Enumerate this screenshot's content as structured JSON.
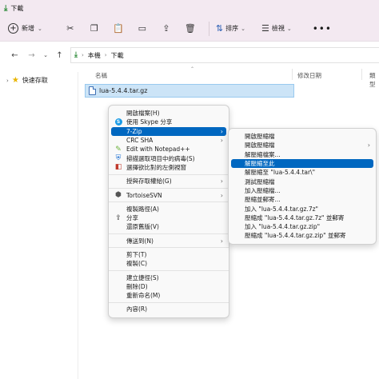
{
  "window": {
    "title": "下載"
  },
  "toolbar": {
    "new_label": "新增",
    "sort_label": "排序",
    "view_label": "檢視",
    "more_label": "•••"
  },
  "address": {
    "back": "←",
    "forward": "→",
    "up": "↑",
    "crumbs": [
      "本機",
      "下載"
    ]
  },
  "sidebar": {
    "quick_access": "快速存取"
  },
  "columns": {
    "name": "名稱",
    "modified": "修改日期",
    "type": "類型"
  },
  "file": {
    "name": "lua-5.4.4.tar.gz"
  },
  "context_menu": {
    "items": [
      {
        "label": "開啟檔案(H)",
        "type": "item"
      },
      {
        "label": "使用 Skype 分享",
        "type": "item",
        "icon": "skype-icon"
      },
      {
        "label": "7-Zip",
        "type": "submenu",
        "selected": true
      },
      {
        "label": "CRC SHA",
        "type": "submenu"
      },
      {
        "label": "Edit with Notepad++",
        "type": "item",
        "icon": "notepad-plus-plus-icon"
      },
      {
        "label": "掃描選取項目中的病毒(S)",
        "type": "item",
        "icon": "shield-icon"
      },
      {
        "label": "選擇欲比對的左側視窗",
        "type": "item",
        "icon": "compare-icon"
      },
      {
        "type": "divider"
      },
      {
        "label": "授與存取權給(G)",
        "type": "submenu"
      },
      {
        "type": "divider"
      },
      {
        "label": "TortoiseSVN",
        "type": "submenu",
        "icon": "tortoise-svn-icon"
      },
      {
        "type": "divider"
      },
      {
        "label": "複製路徑(A)",
        "type": "item"
      },
      {
        "label": "分享",
        "type": "item",
        "icon": "share-icon"
      },
      {
        "label": "還原舊版(V)",
        "type": "item"
      },
      {
        "type": "divider"
      },
      {
        "label": "傳送到(N)",
        "type": "submenu"
      },
      {
        "type": "divider"
      },
      {
        "label": "剪下(T)",
        "type": "item"
      },
      {
        "label": "複製(C)",
        "type": "item"
      },
      {
        "type": "divider"
      },
      {
        "label": "建立捷徑(S)",
        "type": "item"
      },
      {
        "label": "刪除(D)",
        "type": "item"
      },
      {
        "label": "重新命名(M)",
        "type": "item"
      },
      {
        "type": "divider"
      },
      {
        "label": "內容(R)",
        "type": "item"
      }
    ]
  },
  "sevenzip_menu": {
    "items": [
      {
        "label": "開啟壓縮檔",
        "type": "item"
      },
      {
        "label": "開啟壓縮檔",
        "type": "submenu"
      },
      {
        "label": "解壓縮檔案...",
        "type": "item"
      },
      {
        "label": "解壓縮至此",
        "type": "item",
        "selected": true
      },
      {
        "label": "解壓縮至 \"lua-5.4.4.tar\\\"",
        "type": "item"
      },
      {
        "label": "測試壓縮檔",
        "type": "item"
      },
      {
        "label": "加入壓縮檔...",
        "type": "item"
      },
      {
        "label": "壓縮並郵寄...",
        "type": "item"
      },
      {
        "label": "加入 \"lua-5.4.4.tar.gz.7z\"",
        "type": "item"
      },
      {
        "label": "壓縮成 \"lua-5.4.4.tar.gz.7z\" 並郵寄",
        "type": "item"
      },
      {
        "label": "加入 \"lua-5.4.4.tar.gz.zip\"",
        "type": "item"
      },
      {
        "label": "壓縮成 \"lua-5.4.4.tar.gz.zip\" 並郵寄",
        "type": "item"
      }
    ]
  },
  "colors": {
    "accent": "#0067c0",
    "selection": "#cce4f7",
    "titlebar": "#f3e9f1"
  }
}
